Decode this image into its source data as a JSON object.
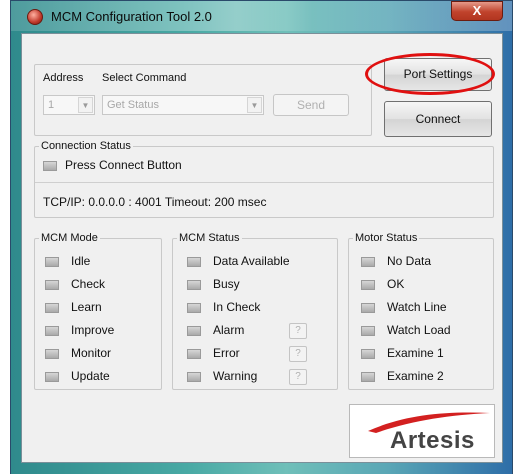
{
  "window": {
    "title": "MCM Configuration Tool 2.0",
    "close_label": "X"
  },
  "top": {
    "address_label": "Address",
    "address_value": "1",
    "command_label": "Select Command",
    "command_value": "Get Status",
    "send_label": "Send",
    "port_settings_label": "Port Settings",
    "connect_label": "Connect"
  },
  "connection": {
    "legend": "Connection Status",
    "status_text": "Press Connect Button",
    "tcpip_text": "TCP/IP: 0.0.0.0 : 4001 Timeout: 200 msec"
  },
  "mcm_mode": {
    "legend": "MCM Mode",
    "items": [
      "Idle",
      "Check",
      "Learn",
      "Improve",
      "Monitor",
      "Update"
    ]
  },
  "mcm_status": {
    "legend": "MCM Status",
    "items": [
      "Data Available",
      "Busy",
      "In Check",
      "Alarm",
      "Error",
      "Warning"
    ],
    "help_label": "?"
  },
  "motor_status": {
    "legend": "Motor Status",
    "items": [
      "No Data",
      "OK",
      "Watch Line",
      "Watch Load",
      "Examine 1",
      "Examine 2"
    ]
  },
  "logo": {
    "text": "Artesis"
  },
  "colors": {
    "highlight_ring": "#e01010",
    "logo_swoosh": "#d32020"
  }
}
